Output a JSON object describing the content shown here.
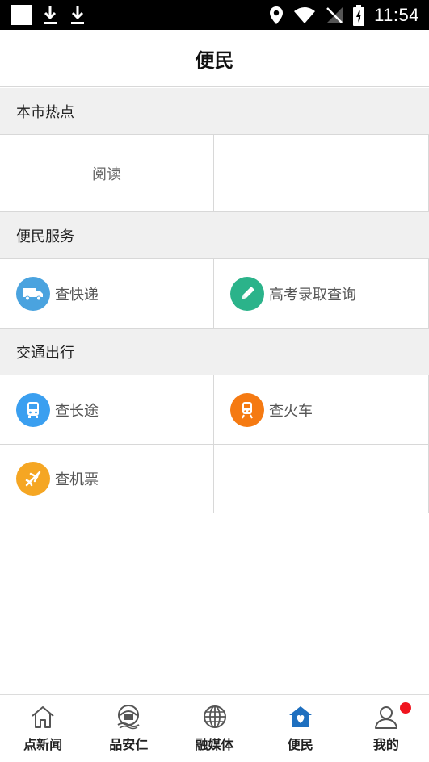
{
  "status_bar": {
    "time": "11:54"
  },
  "header": {
    "title": "便民"
  },
  "sections": [
    {
      "title": "本市热点",
      "items": [
        {
          "label": "阅读"
        },
        {
          "label": ""
        }
      ]
    },
    {
      "title": "便民服务",
      "items": [
        {
          "label": "查快递",
          "icon": "truck-icon",
          "color": "#4aa3df"
        },
        {
          "label": "高考录取查询",
          "icon": "pencil-icon",
          "color": "#2bb38a"
        }
      ]
    },
    {
      "title": "交通出行",
      "items": [
        {
          "label": "查长途",
          "icon": "bus-icon",
          "color": "#3a9ff0"
        },
        {
          "label": "查火车",
          "icon": "train-icon",
          "color": "#f57a12"
        },
        {
          "label": "查机票",
          "icon": "plane-icon",
          "color": "#f5a623"
        }
      ]
    }
  ],
  "bottom_nav": [
    {
      "label": "点新闻",
      "icon": "home-icon"
    },
    {
      "label": "品安仁",
      "icon": "town-logo-icon"
    },
    {
      "label": "融媒体",
      "icon": "globe-icon"
    },
    {
      "label": "便民",
      "icon": "heart-house-icon",
      "active": true,
      "color": "#1e6fbf"
    },
    {
      "label": "我的",
      "icon": "user-icon",
      "badge": true,
      "badge_color": "#f0141e"
    }
  ]
}
